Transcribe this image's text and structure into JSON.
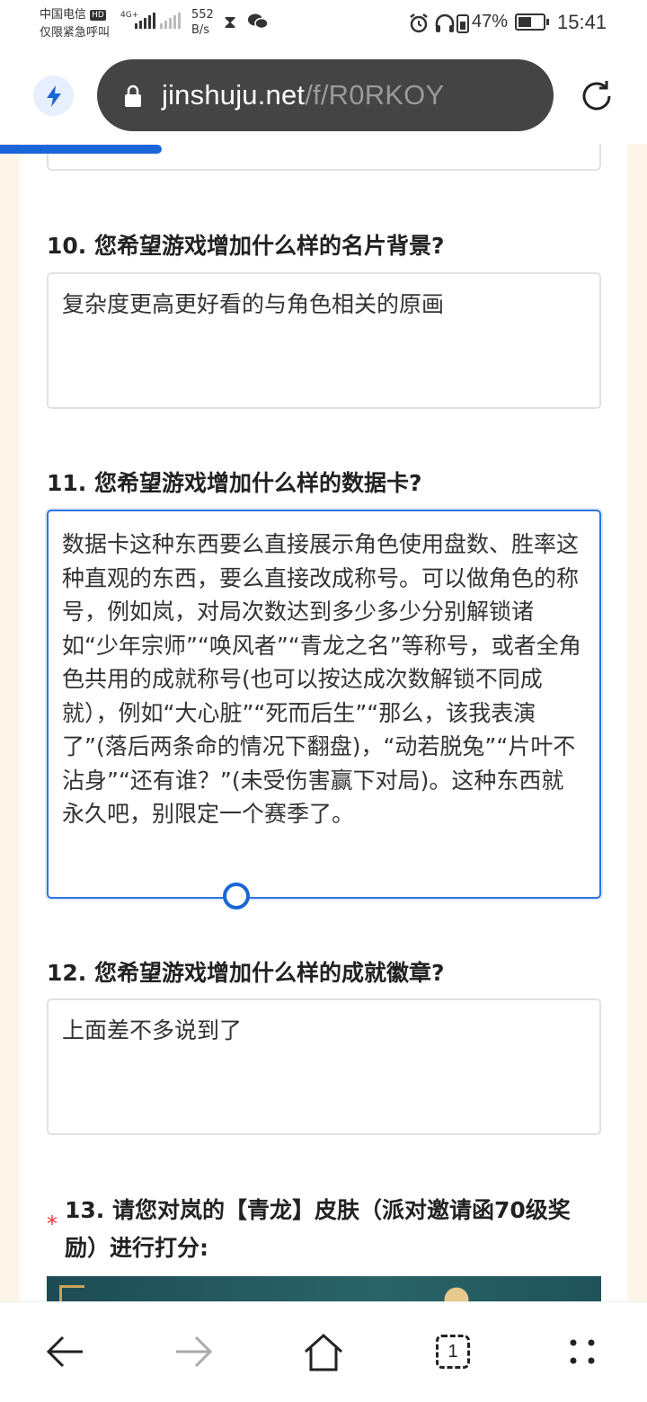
{
  "status_bar": {
    "carrier": "中国电信",
    "hd_badge": "HD",
    "emergency_text": "仅限紧急呼叫",
    "network_type": "4G+",
    "net_speed_value": "552",
    "net_speed_unit": "B/s",
    "battery_percent": "47%",
    "time": "15:41"
  },
  "browser": {
    "url_domain": "jinshuju.net",
    "url_path": "/f/R0RKOY",
    "progress_fraction": 0.25
  },
  "questions": [
    {
      "title": "10. 您希望游戏增加什么样的名片背景?",
      "answer": "复杂度更高更好看的与角色相关的原画"
    },
    {
      "title": "11. 您希望游戏增加什么样的数据卡?",
      "answer": "数据卡这种东西要么直接展示角色使用盘数、胜率这种直观的东西，要么直接改成称号。可以做角色的称号，例如岚，对局次数达到多少多少分别解锁诸如“少年宗师”“唤风者”“青龙之名”等称号，或者全角色共用的成就称号(也可以按达成次数解锁不同成就），例如“大心脏”“死而后生”“那么，该我表演了”(落后两条命的情况下翻盘)，“动若脱兔”“片叶不沾身”“还有谁？”(未受伤害赢下对局)。这种东西就永久吧，别限定一个赛季了。"
    },
    {
      "title": "12. 您希望游戏增加什么样的成就徽章?",
      "answer": "上面差不多说到了"
    },
    {
      "title": "13. 请您对岚的【青龙】皮肤（派对邀请函70级奖励）进行打分:",
      "required_mark": "*"
    }
  ],
  "bottom_nav": {
    "tab_count": "1"
  },
  "colors": {
    "accent": "#1a66d8",
    "url_pill": "#444444",
    "page_bg": "#fdf5ea",
    "required": "#e33333"
  }
}
